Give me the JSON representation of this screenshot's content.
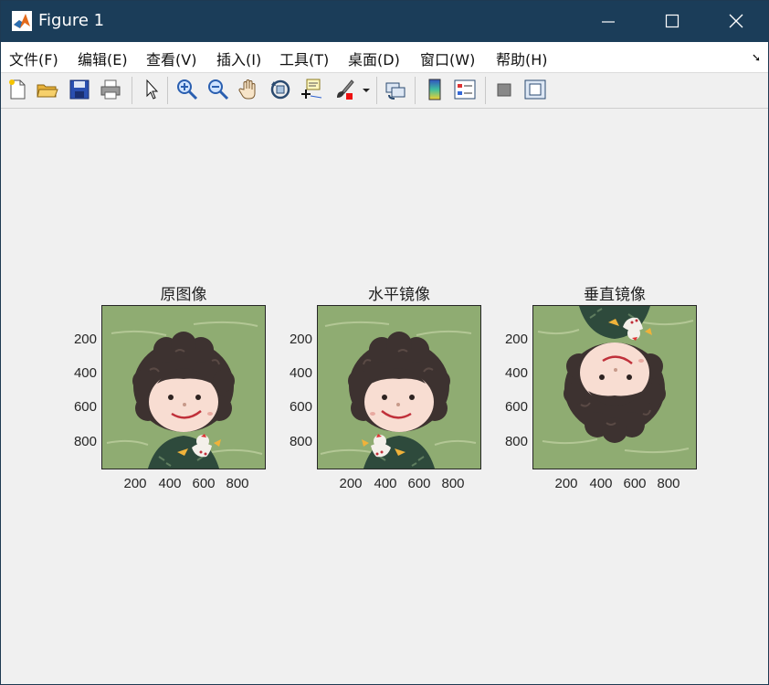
{
  "window": {
    "title": "Figure 1"
  },
  "menu": [
    {
      "label": "文件(F)"
    },
    {
      "label": "编辑(E)"
    },
    {
      "label": "查看(V)"
    },
    {
      "label": "插入(I)"
    },
    {
      "label": "工具(T)"
    },
    {
      "label": "桌面(D)"
    },
    {
      "label": "窗口(W)"
    },
    {
      "label": "帮助(H)"
    }
  ],
  "toolbar": {
    "icons": [
      "new-figure-icon",
      "open-file-icon",
      "save-icon",
      "print-icon",
      "pointer-icon",
      "zoom-in-icon",
      "zoom-out-icon",
      "pan-icon",
      "rotate-3d-icon",
      "data-cursor-icon",
      "brush-icon",
      "link-plot-icon",
      "colorbar-icon",
      "legend-icon",
      "hide-plot-tools-icon",
      "show-plot-tools-icon"
    ]
  },
  "subplots": [
    {
      "title": "原图像",
      "orientation": "original",
      "yticks": [
        "200",
        "400",
        "600",
        "800"
      ],
      "xticks": [
        "200",
        "400",
        "600",
        "800"
      ]
    },
    {
      "title": "水平镜像",
      "orientation": "horizontal-mirror",
      "yticks": [
        "200",
        "400",
        "600",
        "800"
      ],
      "xticks": [
        "200",
        "400",
        "600",
        "800"
      ]
    },
    {
      "title": "垂直镜像",
      "orientation": "vertical-mirror",
      "yticks": [
        "200",
        "400",
        "600",
        "800"
      ],
      "xticks": [
        "200",
        "400",
        "600",
        "800"
      ]
    }
  ],
  "colors": {
    "titlebar": "#1b3d59",
    "background": "#8fac72",
    "hair": "#3d3230",
    "skin": "#f8ddd2",
    "sweater": "#2e4a3c",
    "smile": "#c0303a"
  }
}
